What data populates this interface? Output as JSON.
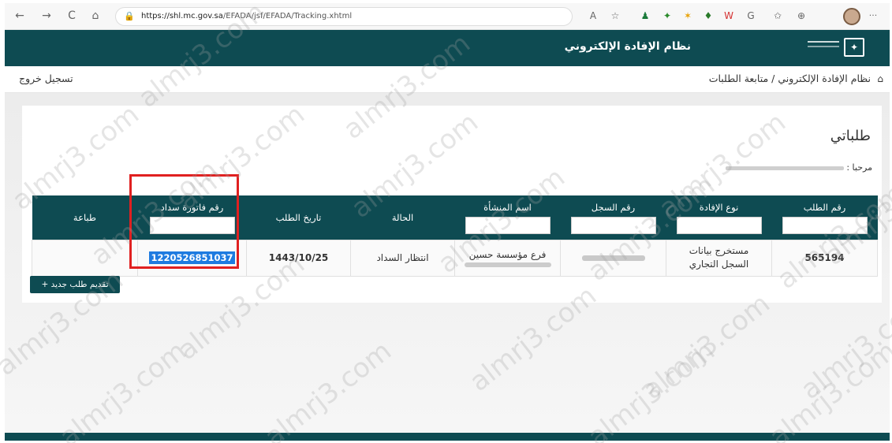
{
  "browser": {
    "url_host": "https://shl.mc.gov.sa",
    "url_path": "/EFADA/jsf/EFADA/Tracking.xhtml",
    "back_icon": "←",
    "forward_icon": "→",
    "refresh_icon": "C",
    "home_icon": "⌂",
    "menu_icon": "···"
  },
  "header": {
    "app_title": "نظام الإفادة الإلكتروني"
  },
  "breadcrumb": {
    "home_icon": "⌂",
    "text": "نظام الإفادة الإلكتروني / متابعة الطلبات",
    "logout": "تسجيل خروج"
  },
  "page": {
    "heading": "طلباتي",
    "welcome": "مرحبا :"
  },
  "table": {
    "headers": {
      "request_no": "رقم الطلب",
      "certificate_type": "نوع الإفادة",
      "record_no": "رقم السجل",
      "entity_name": "اسم المنشأة",
      "status": "الحالة",
      "request_date": "تاريخ الطلب",
      "sadad_invoice": "رقم فاتورة سداد",
      "print": "طباعة"
    },
    "rows": [
      {
        "request_no": "565194",
        "certificate_type": "مستخرج بيانات السجل التجاري",
        "record_no": "",
        "entity_name": "فرع مؤسسة حسين",
        "status": "انتظار السداد",
        "request_date": "1443/10/25",
        "sadad_invoice": "1220526851037",
        "print": ""
      }
    ]
  },
  "actions": {
    "new_request": "تقديم طلب جديد +"
  },
  "watermark": "almrj3.com"
}
